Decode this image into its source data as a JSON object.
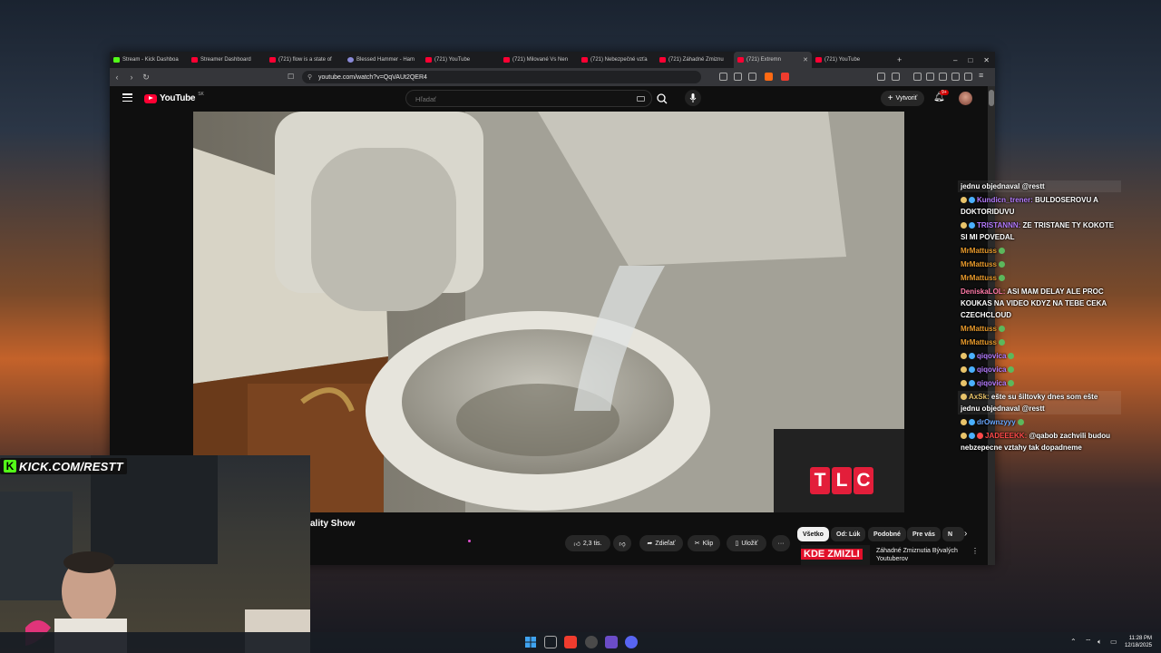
{
  "browser": {
    "tabs": [
      {
        "label": "Stream - Kick Dashboa",
        "icon": "kick"
      },
      {
        "label": "Streamer Dashboard",
        "icon": "kick-red"
      },
      {
        "label": "(721) flow is a state of",
        "icon": "youtube"
      },
      {
        "label": "Blessed Hammer - Ham",
        "icon": "gear"
      },
      {
        "label": "(721) YouTube",
        "icon": "youtube"
      },
      {
        "label": "(721) Milované Vs Nen",
        "icon": "youtube"
      },
      {
        "label": "(721) Nebezpečné vzťa",
        "icon": "youtube"
      },
      {
        "label": "(721) Záhadné Zmiznu",
        "icon": "youtube"
      },
      {
        "label": "(721) Extremn",
        "icon": "youtube",
        "active": true
      },
      {
        "label": "(721) YouTube",
        "icon": "youtube"
      }
    ],
    "new_tab": "+",
    "window_controls": {
      "minimize": "–",
      "maximize": "□",
      "close": "✕"
    },
    "url": "youtube.com/watch?v=QqVAUt2QER4"
  },
  "youtube": {
    "logo_text": "YouTube",
    "logo_country": "SK",
    "search_placeholder": "Hľadať",
    "create_label": "Vytvoriť",
    "notif_count": "9+",
    "video_title": "ality Show",
    "actions": {
      "like_count": "2,3 tis.",
      "share": "Zdieľať",
      "clip": "Klip",
      "save": "Uložiť",
      "more": "···"
    },
    "chips": [
      "Všetko",
      "Od: Lúk",
      "Podobné",
      "Pre vás",
      "N"
    ],
    "recommendation": {
      "thumb_text": "KDE ZMIZLI",
      "title": "Záhadné Zmiznutia Bývalých Youtuberov"
    },
    "player_logo": [
      "T",
      "L",
      "C"
    ]
  },
  "chat": [
    {
      "user": "",
      "text": "jednu objednaval @restt",
      "user_color": "#ffffff",
      "badges": 0,
      "highlight": true
    },
    {
      "user": "Kundicn_trener",
      "text": "BULDOSEROVU A DOKTORIDUVU",
      "user_color": "#b57cff",
      "badges": 2
    },
    {
      "user": "TRISTANNN",
      "text": "ZE TRISTANE TY KOKOTE SI MI POVEDAL",
      "user_color": "#b57cff",
      "badges": 2
    },
    {
      "user": "MrMattuss",
      "text": "",
      "user_color": "#e89a2c",
      "badges": 0,
      "check": true
    },
    {
      "user": "MrMattuss",
      "text": "",
      "user_color": "#e89a2c",
      "badges": 0,
      "check": true
    },
    {
      "user": "MrMattuss",
      "text": "",
      "user_color": "#e89a2c",
      "badges": 0,
      "check": true
    },
    {
      "user": "DeniskaLOL",
      "text": "ASI MAM DELAY ALE PROC KOUKAS NA VIDEO KDYZ NA TEBE CEKA CZECHCLOUD",
      "user_color": "#ff7aa8",
      "badges": 0
    },
    {
      "user": "MrMattuss",
      "text": "",
      "user_color": "#e89a2c",
      "badges": 0,
      "check": true
    },
    {
      "user": "MrMattuss",
      "text": "",
      "user_color": "#e89a2c",
      "badges": 0,
      "check": true
    },
    {
      "user": "qiqovica",
      "text": "",
      "user_color": "#b57cff",
      "badges": 2,
      "check": true
    },
    {
      "user": "qiqovica",
      "text": "",
      "user_color": "#b57cff",
      "badges": 2,
      "check": true
    },
    {
      "user": "qiqovica",
      "text": "",
      "user_color": "#b57cff",
      "badges": 2,
      "check": true
    },
    {
      "user": "AxSk",
      "text": "ešte su šiltovky dnes som ešte jednu objednaval @restt",
      "user_color": "#e8c36a",
      "badges": 1,
      "highlight": true
    },
    {
      "user": "drOwnzyyy",
      "text": "",
      "user_color": "#6aa8ff",
      "badges": 2,
      "check": true
    },
    {
      "user": "JADEEEKK",
      "text": "@qabob zachvili budou nebzepecne vztahy tak dopadneme",
      "user_color": "#ff4a4a",
      "badges": 3
    }
  ],
  "overlay": {
    "kick_url": "KICK.COM/RESTT"
  },
  "taskbar": {
    "time": "11:28 PM",
    "date": "12/18/2025"
  }
}
